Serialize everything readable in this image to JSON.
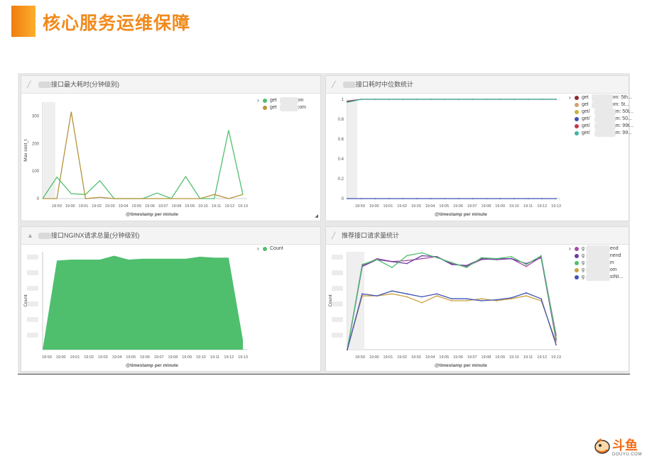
{
  "slide": {
    "title": "核心服务运维保障",
    "logo_text": "斗鱼",
    "logo_sub": "DOUYU.COM"
  },
  "colors": {
    "accent": "#f08a1c",
    "green": "#4fbf6e",
    "olive": "#b5943a"
  },
  "panels": [
    {
      "title": "接口最大耗时(分钟级别)",
      "icon": "line-chart-icon",
      "ylabel": "Max cost_t",
      "xlabel": "@timestamp per minute",
      "legend": [
        {
          "label_start": "get",
          "label_end": "om",
          "color": "#4fbf6e"
        },
        {
          "label_start": "get",
          "label_end": "com",
          "color": "#b5943a"
        }
      ]
    },
    {
      "title": "接口耗时中位数统计",
      "icon": "line-chart-icon",
      "ylabel": "",
      "xlabel": "@timestamp per minute",
      "legend": [
        {
          "label_start": "get",
          "label_end": "om: 5th...",
          "color": "#8b2a2a"
        },
        {
          "label_start": "get",
          "label_end": "om: 5t...",
          "color": "#d6a06a"
        },
        {
          "label_start": "get/",
          "label_end": "om: 50t...",
          "color": "#c7b23e"
        },
        {
          "label_start": "get/",
          "label_end": "om: 50...",
          "color": "#3f52b5"
        },
        {
          "label_start": "get/",
          "label_end": "om: 99t...",
          "color": "#c4384a"
        },
        {
          "label_start": "get/",
          "label_end": "om: 99...",
          "color": "#3bb5a2"
        }
      ]
    },
    {
      "title": "接口NGINX请求总量(分钟级别)",
      "icon": "area-chart-icon",
      "ylabel": "Count",
      "xlabel": "@timestamp per minute",
      "legend": [
        {
          "label_start": "",
          "label_end": "Count",
          "color": "#4fbf6e"
        }
      ]
    },
    {
      "title": "推荐接口请求量统计",
      "icon": "line-chart-icon",
      "ylabel": "Count",
      "xlabel": "@timestamp per minute",
      "legend": [
        {
          "label_start": "g",
          "label_end": "end",
          "color": "#a64ca6"
        },
        {
          "label_start": "g",
          "label_end": "nend",
          "color": "#6a3ea0"
        },
        {
          "label_start": "g",
          "label_end": "m",
          "color": "#4fbf6e"
        },
        {
          "label_start": "g",
          "label_end": "om",
          "color": "#c9a13e"
        },
        {
          "label_start": "g",
          "label_end": "stNt...",
          "color": "#3f52b5"
        }
      ]
    }
  ],
  "chart_data": [
    {
      "type": "line",
      "ylim": [
        0,
        350
      ],
      "yticks": [
        0,
        100,
        200,
        300
      ],
      "categories": [
        "18:59",
        "19:00",
        "19:01",
        "19:02",
        "19:03",
        "19:04",
        "19:05",
        "19:06",
        "19:07",
        "19:08",
        "19:09",
        "19:10",
        "19:11",
        "19:12",
        "19:13"
      ],
      "series": [
        {
          "color": "#4fbf6e",
          "values": [
            0,
            78,
            18,
            15,
            65,
            0,
            0,
            0,
            20,
            0,
            80,
            0,
            0,
            248,
            15
          ]
        },
        {
          "color": "#b5943a",
          "values": [
            0,
            0,
            315,
            0,
            5,
            0,
            0,
            0,
            0,
            0,
            0,
            0,
            15,
            0,
            15
          ]
        }
      ]
    },
    {
      "type": "line",
      "ylim": [
        0,
        1
      ],
      "yticks": [
        0,
        0.2,
        0.4,
        0.6,
        0.8,
        1
      ],
      "categories": [
        "18:59",
        "19:00",
        "19:01",
        "19:02",
        "19:03",
        "19:04",
        "19:05",
        "19:06",
        "19:07",
        "19:08",
        "19:09",
        "19:10",
        "19:11",
        "19:12",
        "19:13"
      ],
      "series": [
        {
          "color": "#8b2a2a",
          "values": [
            0.98,
            1,
            1,
            1,
            1,
            1,
            1,
            1,
            1,
            1,
            1,
            1,
            1,
            1,
            1,
            1
          ]
        },
        {
          "color": "#3bb5a2",
          "values": [
            0.97,
            1,
            1,
            1,
            1,
            1,
            1,
            1,
            1,
            1,
            1,
            1,
            1,
            1,
            1,
            1
          ]
        },
        {
          "color": "#3f52b5",
          "values": [
            0,
            0,
            0,
            0,
            0,
            0,
            0,
            0,
            0,
            0,
            0,
            0,
            0,
            0,
            0,
            0
          ]
        }
      ]
    },
    {
      "type": "area",
      "ylim": [
        0,
        100
      ],
      "categories": [
        "18:59",
        "19:00",
        "19:01",
        "19:02",
        "19:03",
        "19:04",
        "19:05",
        "19:06",
        "19:07",
        "19:08",
        "19:09",
        "19:10",
        "19:11",
        "19:12",
        "19:13"
      ],
      "series": [
        {
          "color": "#4fbf6e",
          "values": [
            0,
            91,
            92,
            92,
            92,
            96,
            92,
            93,
            93,
            93,
            93,
            95,
            94,
            94,
            10
          ]
        }
      ]
    },
    {
      "type": "line",
      "ylim": [
        0,
        100
      ],
      "categories": [
        "18:59",
        "19:00",
        "19:01",
        "19:02",
        "19:03",
        "19:04",
        "19:05",
        "19:06",
        "19:07",
        "19:08",
        "19:09",
        "19:10",
        "19:11",
        "19:12",
        "19:13"
      ],
      "series": [
        {
          "color": "#a64ca6",
          "values": [
            0,
            86,
            93,
            90,
            91,
            93,
            95,
            88,
            85,
            92,
            93,
            93,
            85,
            95,
            15
          ]
        },
        {
          "color": "#6a3ea0",
          "values": [
            0,
            85,
            92,
            90,
            88,
            96,
            95,
            87,
            86,
            93,
            92,
            93,
            88,
            94,
            10
          ]
        },
        {
          "color": "#4fbf6e",
          "values": [
            0,
            87,
            92,
            84,
            96,
            99,
            94,
            89,
            84,
            94,
            93,
            95,
            87,
            96,
            12
          ]
        },
        {
          "color": "#c9a13e",
          "values": [
            0,
            55,
            55,
            57,
            54,
            48,
            55,
            50,
            50,
            52,
            50,
            52,
            55,
            50,
            8
          ]
        },
        {
          "color": "#3f52b5",
          "values": [
            0,
            57,
            55,
            60,
            57,
            54,
            57,
            52,
            52,
            50,
            51,
            53,
            58,
            52,
            5
          ]
        }
      ]
    }
  ]
}
